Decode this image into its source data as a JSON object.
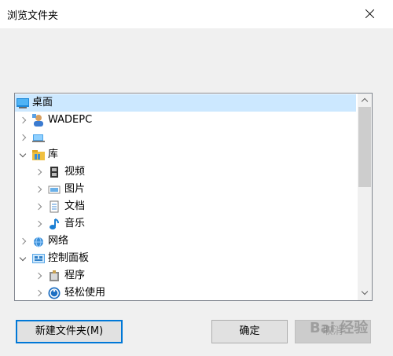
{
  "window": {
    "title": "浏览文件夹"
  },
  "tree": {
    "items": [
      {
        "label": "桌面",
        "icon": "desktop-icon",
        "expand": "",
        "selected": true
      },
      {
        "label": "WADEPC",
        "icon": "user-icon",
        "expand": "collapsed"
      },
      {
        "label": "",
        "icon": "computer-icon",
        "expand": "collapsed"
      },
      {
        "label": "库",
        "icon": "library-icon",
        "expand": "expanded"
      },
      {
        "label": "视频",
        "icon": "video-icon",
        "expand": "collapsed"
      },
      {
        "label": "图片",
        "icon": "pictures-icon",
        "expand": "collapsed"
      },
      {
        "label": "文档",
        "icon": "documents-icon",
        "expand": "collapsed"
      },
      {
        "label": "音乐",
        "icon": "music-icon",
        "expand": "collapsed"
      },
      {
        "label": "网络",
        "icon": "network-icon",
        "expand": "collapsed"
      },
      {
        "label": "控制面板",
        "icon": "control-panel-icon",
        "expand": "expanded"
      },
      {
        "label": "程序",
        "icon": "programs-icon",
        "expand": "collapsed"
      },
      {
        "label": "轻松使用",
        "icon": "ease-of-access-icon",
        "expand": "collapsed"
      }
    ]
  },
  "buttons": {
    "new_folder": "新建文件夹(M)",
    "ok": "确定",
    "cancel": "取消"
  },
  "watermark": "Bai 经验"
}
